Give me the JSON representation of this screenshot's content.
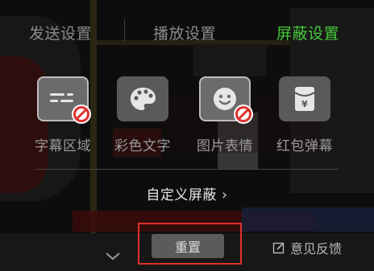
{
  "tabs": [
    {
      "label": "发送设置",
      "active": false
    },
    {
      "label": "播放设置",
      "active": false
    },
    {
      "label": "屏蔽设置",
      "active": true
    }
  ],
  "block_options": [
    {
      "label": "字幕区域",
      "icon": "subtitle-icon",
      "blocked": true
    },
    {
      "label": "彩色文字",
      "icon": "palette-icon",
      "blocked": false
    },
    {
      "label": "图片表情",
      "icon": "emoji-icon",
      "blocked": true
    },
    {
      "label": "红包弹幕",
      "icon": "red-envelope-icon",
      "blocked": false
    }
  ],
  "custom_block": {
    "label": "自定义屏蔽",
    "chevron": "›"
  },
  "reset_label": "重置",
  "feedback_label": "意见反馈",
  "colors": {
    "accent": "#46c93a",
    "highlight_box": "#e0312c",
    "ban": "#e0312c"
  }
}
